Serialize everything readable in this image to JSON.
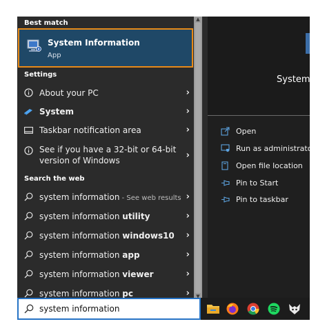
{
  "sections": {
    "best_match": "Best match",
    "settings": "Settings",
    "search_web": "Search the web"
  },
  "best_match": {
    "title": "System Information",
    "subtitle": "App"
  },
  "settings_items": [
    {
      "label": "About your PC",
      "icon": "info-icon"
    },
    {
      "label": "System",
      "icon": "system-icon"
    },
    {
      "label": "Taskbar notification area",
      "icon": "taskbar-icon"
    },
    {
      "label": "See if you have a 32-bit or 64-bit version of Windows",
      "icon": "info-icon"
    }
  ],
  "web_items": [
    {
      "base": "system information",
      "bold": "",
      "suffix": " - See web results"
    },
    {
      "base": "system information ",
      "bold": "utility",
      "suffix": ""
    },
    {
      "base": "system information ",
      "bold": "windows10",
      "suffix": ""
    },
    {
      "base": "system information ",
      "bold": "app",
      "suffix": ""
    },
    {
      "base": "system information ",
      "bold": "viewer",
      "suffix": ""
    },
    {
      "base": "system information ",
      "bold": "pc",
      "suffix": ""
    }
  ],
  "search": {
    "value": "system information"
  },
  "detail": {
    "title": "System",
    "actions": [
      {
        "label": "Open",
        "icon": "open-icon"
      },
      {
        "label": "Run as administrator",
        "icon": "shield-icon"
      },
      {
        "label": "Open file location",
        "icon": "file-location-icon"
      },
      {
        "label": "Pin to Start",
        "icon": "pin-icon"
      },
      {
        "label": "Pin to taskbar",
        "icon": "pin-icon"
      }
    ]
  },
  "taskbar_icons": [
    "file-explorer-icon",
    "firefox-icon",
    "chrome-icon",
    "spotify-icon",
    "app-icon"
  ],
  "colors": {
    "accent": "#e88a18",
    "selected": "#1f4867",
    "search_border": "#2673c5"
  }
}
